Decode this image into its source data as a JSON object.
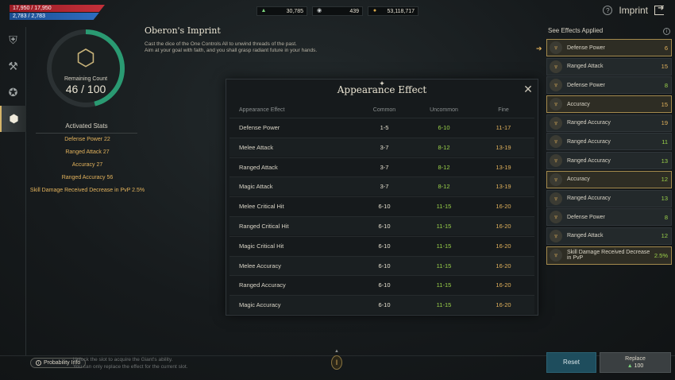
{
  "status": {
    "hp": "17,950 / 17,950",
    "mp": "2,783 / 2,783"
  },
  "currencies": [
    {
      "icon": "green-crystal-icon",
      "value": "30,785"
    },
    {
      "icon": "eye-token-icon",
      "value": "439"
    },
    {
      "icon": "gold-coin-icon",
      "value": "53,118,717"
    }
  ],
  "header": {
    "title": "Imprint"
  },
  "page": {
    "title": "Oberon's Imprint",
    "desc1": "Cast the dice of the One Controls All to unwind threads of the past.",
    "desc2": "Aim at your goal with faith, and you shall grasp radiant future in your hands."
  },
  "dial": {
    "label": "Remaining Count",
    "value": "46 / 100",
    "progress": 0.46
  },
  "activated": {
    "title": "Activated Stats",
    "items": [
      "Defense Power 22",
      "Ranged Attack 27",
      "Accuracy 27",
      "Ranged Accuracy 56",
      "Skill Damage Received Decrease in PvP 2.5%"
    ]
  },
  "modal": {
    "title": "Appearance Effect",
    "headers": [
      "Appearance Effect",
      "Common",
      "Uncommon",
      "Fine"
    ],
    "rows": [
      [
        "Defense Power",
        "1-5",
        "6-10",
        "11-17"
      ],
      [
        "Melee Attack",
        "3-7",
        "8-12",
        "13-19"
      ],
      [
        "Ranged Attack",
        "3-7",
        "8-12",
        "13-19"
      ],
      [
        "Magic Attack",
        "3-7",
        "8-12",
        "13-19"
      ],
      [
        "Melee Critical Hit",
        "6-10",
        "11-15",
        "16-20"
      ],
      [
        "Ranged Critical Hit",
        "6-10",
        "11-15",
        "16-20"
      ],
      [
        "Magic Critical Hit",
        "6-10",
        "11-15",
        "16-20"
      ],
      [
        "Melee Accuracy",
        "6-10",
        "11-15",
        "16-20"
      ],
      [
        "Ranged Accuracy",
        "6-10",
        "11-15",
        "16-20"
      ],
      [
        "Magic Accuracy",
        "6-10",
        "11-15",
        "16-20"
      ]
    ]
  },
  "effects": {
    "title": "See Effects Applied",
    "items": [
      {
        "name": "Defense Power",
        "value": "6",
        "style": "gold",
        "color": "gold"
      },
      {
        "name": "Ranged Attack",
        "value": "15",
        "style": "normal",
        "color": "gold"
      },
      {
        "name": "Defense Power",
        "value": "8",
        "style": "normal",
        "color": "green"
      },
      {
        "name": "Accuracy",
        "value": "15",
        "style": "gold",
        "color": "gold"
      },
      {
        "name": "Ranged Accuracy",
        "value": "19",
        "style": "normal",
        "color": "gold"
      },
      {
        "name": "Ranged Accuracy",
        "value": "11",
        "style": "normal",
        "color": "green"
      },
      {
        "name": "Ranged Accuracy",
        "value": "13",
        "style": "normal",
        "color": "green"
      },
      {
        "name": "Accuracy",
        "value": "12",
        "style": "gold",
        "color": "green"
      },
      {
        "name": "Ranged Accuracy",
        "value": "13",
        "style": "normal",
        "color": "green"
      },
      {
        "name": "Defense Power",
        "value": "8",
        "style": "normal",
        "color": "green"
      },
      {
        "name": "Ranged Attack",
        "value": "12",
        "style": "normal",
        "color": "green"
      },
      {
        "name": "Skill Damage Received Decrease in PvP",
        "value": "2.5%",
        "style": "gold",
        "color": "green"
      }
    ]
  },
  "bottom": {
    "probability_label": "Probability Info",
    "hint1": "Unlock the slot to acquire the Giant's ability.",
    "hint2": "You can only replace the effect for the current slot.",
    "index_label": "I",
    "reset_label": "Reset",
    "replace_label": "Replace",
    "replace_cost": "100"
  }
}
